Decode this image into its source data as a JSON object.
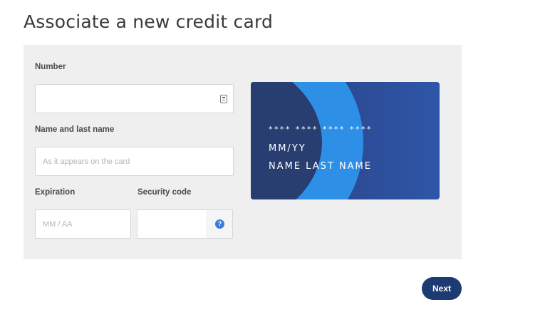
{
  "page": {
    "title": "Associate a new credit card"
  },
  "form": {
    "number": {
      "label": "Number",
      "value": "",
      "placeholder": ""
    },
    "name": {
      "label": "Name and last name",
      "value": "",
      "placeholder": "As it appears on the card"
    },
    "expiration": {
      "label": "Expiration",
      "value": "",
      "placeholder": "MM / AA"
    },
    "security_code": {
      "label": "Security code",
      "value": "",
      "placeholder": ""
    },
    "help_glyph": "?"
  },
  "card_preview": {
    "number": "**** **** **** ****",
    "expiry": "MM/YY",
    "holder": "NAME LAST NAME",
    "colors": {
      "base": "#2e56a8",
      "arc": "#2d8fe6",
      "inner": "#283d70"
    }
  },
  "actions": {
    "next_label": "Next"
  },
  "colors": {
    "panel": "#efefef",
    "primary_button": "#1d3a73",
    "help_icon": "#3b7ddd"
  },
  "icons": {
    "card_type": "card-type-icon",
    "help": "help-icon"
  }
}
